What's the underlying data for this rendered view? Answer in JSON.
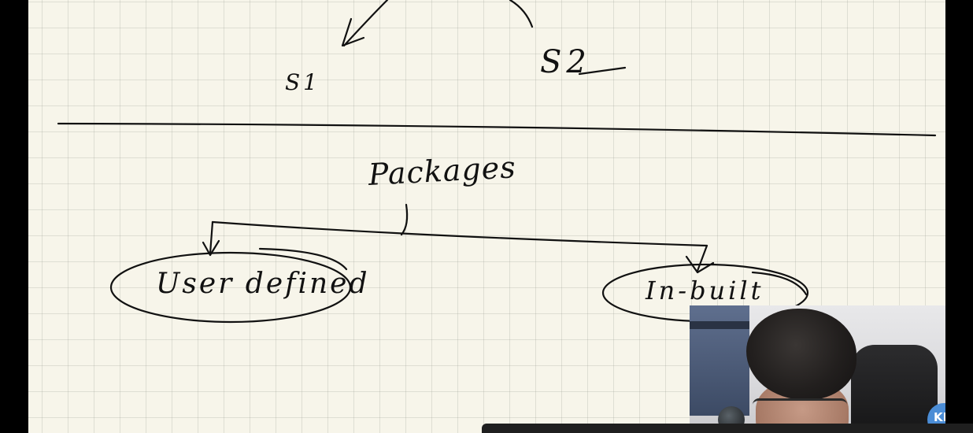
{
  "whiteboard": {
    "labels": {
      "s1": "S1",
      "s2": "S2",
      "packages": "Packages",
      "user_defined": "User defined",
      "in_built": "In-built"
    }
  },
  "webcam": {
    "logo_text": "KK"
  }
}
